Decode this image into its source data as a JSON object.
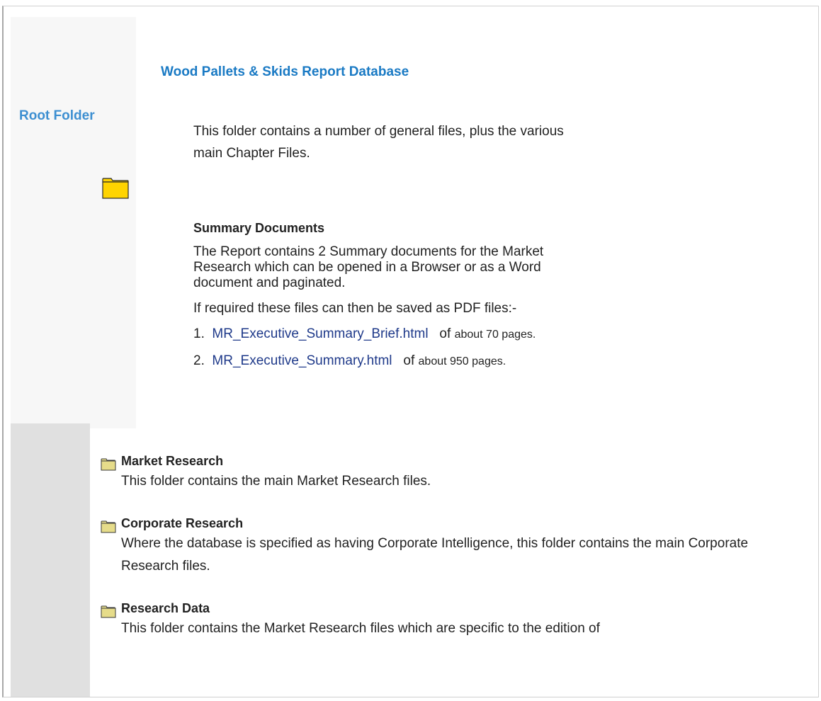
{
  "header": {
    "title": "Wood Pallets & Skids Report Database",
    "root_folder_label": "Root Folder"
  },
  "intro": {
    "text": "This folder contains a number of general files, plus the various main Chapter Files."
  },
  "summary": {
    "heading": "Summary Documents",
    "description": "The Report contains 2 Summary documents for the Market Research which can be opened in a Browser or as a Word document and paginated.",
    "pdf_note": "If required these files can then be saved as PDF files:-",
    "documents": [
      {
        "number": "1.",
        "link": "MR_Executive_Summary_Brief.html",
        "of": "of",
        "pages": "about 70 pages."
      },
      {
        "number": "2.",
        "link": "MR_Executive_Summary.html",
        "of": "of",
        "pages": "about 950 pages."
      }
    ]
  },
  "folders": [
    {
      "name": "Market Research",
      "description": "This folder contains the main Market Research files."
    },
    {
      "name": "Corporate Research",
      "description": "Where the database is specified as having Corporate Intelligence, this folder contains the main Corporate Research files."
    },
    {
      "name": "Research Data",
      "description": "This folder contains the Market Research files which are specific to the edition of"
    }
  ],
  "colors": {
    "title_blue": "#1a7ac4",
    "link_blue": "#1f3a8a",
    "folder_yellow": "#ffd400"
  },
  "icons": {
    "root_folder": "folder-icon",
    "subfolder": "folder-icon"
  }
}
